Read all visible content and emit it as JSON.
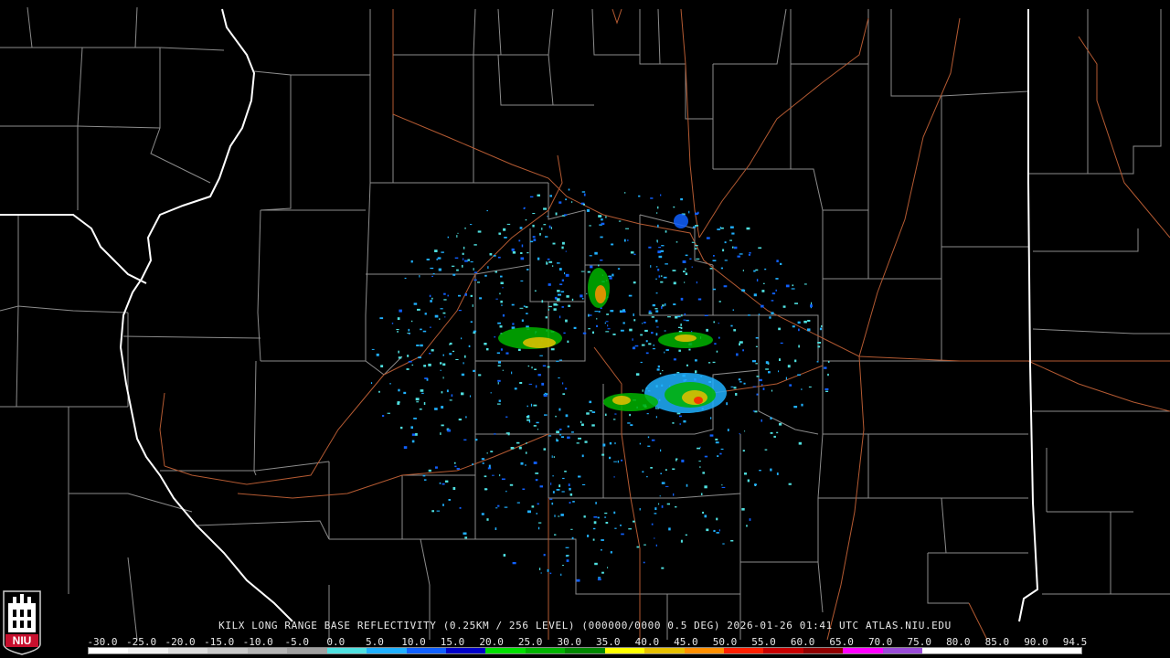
{
  "caption": {
    "text": "KILX LONG RANGE BASE REFLECTIVITY (0.25KM / 256 LEVEL) (000000/0000 0.5 DEG) 2026-01-26 01:41 UTC  ATLAS.NIU.EDU"
  },
  "legend": {
    "labels": [
      "-30.0",
      "-25.0",
      "-20.0",
      "-15.0",
      "-10.0",
      "-5.0",
      "0.0",
      "5.0",
      "10.0",
      "15.0",
      "20.0",
      "25.0",
      "30.0",
      "35.0",
      "40.0",
      "45.0",
      "50.0",
      "55.0",
      "60.0",
      "65.0",
      "70.0",
      "75.0",
      "80.0",
      "85.0",
      "90.0",
      "94.5"
    ],
    "colors": [
      "#ffffff",
      "#f0f0f0",
      "#dcdcdc",
      "#c8c8c8",
      "#b4b4b4",
      "#a0a0a0",
      "#4fe0e0",
      "#20b0ff",
      "#1060ff",
      "#0000c8",
      "#00e000",
      "#00b400",
      "#008800",
      "#ffff00",
      "#e6c000",
      "#ff9000",
      "#ff2000",
      "#c80000",
      "#900000",
      "#ff00ff",
      "#9a4cd8",
      "#ffffff",
      "#ffffff",
      "#ffffff",
      "#ffffff"
    ]
  },
  "logo": {
    "text": "NIU",
    "color": "#c8102e"
  },
  "map": {
    "background": "#000000",
    "county_line_color": "#9a9a9a",
    "state_line_color": "#ffffff",
    "highway_color": "#b45a32"
  }
}
